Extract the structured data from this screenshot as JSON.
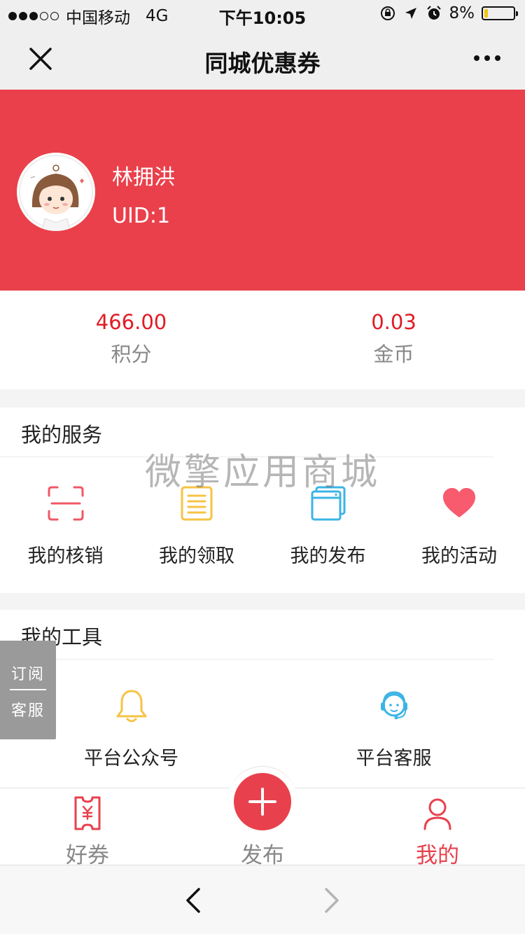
{
  "status_bar": {
    "carrier": "中国移动",
    "network": "4G",
    "time": "下午10:05",
    "battery": "8%",
    "battery_level": 0.08,
    "signal_bars_filled": 3,
    "signal_bars_total": 5
  },
  "navbar": {
    "title": "同城优惠券"
  },
  "profile": {
    "name": "林拥洪",
    "uid": "UID:1"
  },
  "stats": [
    {
      "value": "466.00",
      "label": "积分"
    },
    {
      "value": "0.03",
      "label": "金币"
    }
  ],
  "services": {
    "title": "我的服务",
    "items": [
      {
        "label": "我的核销",
        "icon": "scan-icon",
        "color": "#f05865"
      },
      {
        "label": "我的领取",
        "icon": "document-icon",
        "color": "#f6c344"
      },
      {
        "label": "我的发布",
        "icon": "browser-window-icon",
        "color": "#3bb4e5"
      },
      {
        "label": "我的活动",
        "icon": "heart-icon",
        "color": "#f85a6e"
      }
    ]
  },
  "tools": {
    "title": "我的工具",
    "items": [
      {
        "label": "平台公众号",
        "icon": "bell-icon",
        "color": "#f6c344"
      },
      {
        "label": "平台客服",
        "icon": "customer-service-icon",
        "color": "#3bb4e5"
      }
    ]
  },
  "watermark": "微擎应用商城",
  "float_panel": {
    "subscribe": "订阅",
    "service": "客服"
  },
  "tabbar": {
    "active_color": "#e8414d",
    "tabs": [
      {
        "label": "好券",
        "icon": "coupon-icon"
      },
      {
        "label": "发布",
        "icon": "plus-icon"
      },
      {
        "label": "我的",
        "icon": "user-icon",
        "active": true
      }
    ]
  },
  "colors": {
    "header_red": "#ea404b",
    "value_red": "#e11b24"
  }
}
